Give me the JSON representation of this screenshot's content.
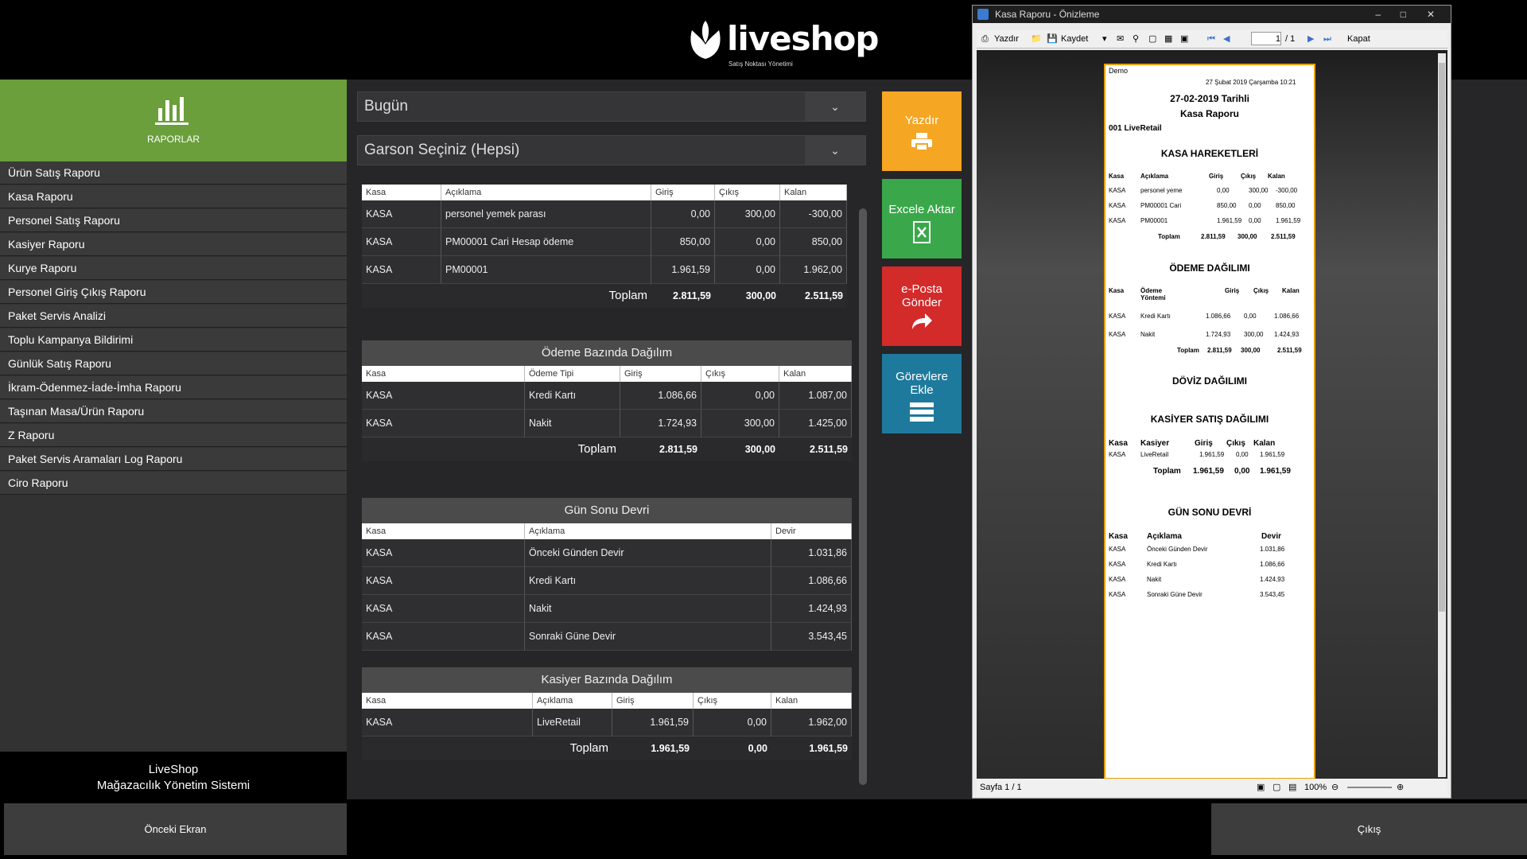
{
  "app": {
    "logo_word": "liveshop",
    "logo_tagline": "Satış Noktası Yönetimi"
  },
  "sidebar": {
    "header_label": "RAPORLAR",
    "items": [
      {
        "label": "Ürün Satış Raporu"
      },
      {
        "label": "Kasa Raporu"
      },
      {
        "label": "Personel Satış Raporu"
      },
      {
        "label": "Kasiyer Raporu"
      },
      {
        "label": "Kurye Raporu"
      },
      {
        "label": "Personel Giriş Çıkış Raporu"
      },
      {
        "label": "Paket Servis Analizi"
      },
      {
        "label": "Toplu Kampanya Bildirimi"
      },
      {
        "label": "Günlük Satış Raporu"
      },
      {
        "label": "İkram-Ödenmez-İade-İmha Raporu"
      },
      {
        "label": "Taşınan Masa/Ürün Raporu"
      },
      {
        "label": "Z Raporu"
      },
      {
        "label": "Paket Servis Aramaları Log Raporu"
      },
      {
        "label": "Ciro Raporu"
      }
    ],
    "brand_line1": "LiveShop",
    "brand_line2": "Mağazacılık Yönetim Sistemi"
  },
  "filters": {
    "date": "Bugün",
    "waiter": "Garson Seçiniz (Hepsi)"
  },
  "kasa_table": {
    "headers": [
      "Kasa",
      "Açıklama",
      "Giriş",
      "Çıkış",
      "Kalan"
    ],
    "rows": [
      [
        "KASA",
        "personel yemek parası",
        "0,00",
        "300,00",
        "-300,00"
      ],
      [
        "KASA",
        "PM00001  Cari Hesap ödeme",
        "850,00",
        "0,00",
        "850,00"
      ],
      [
        "KASA",
        "PM00001",
        "1.961,59",
        "0,00",
        "1.962,00"
      ]
    ],
    "total_label": "Toplam",
    "totals": [
      "2.811,59",
      "300,00",
      "2.511,59"
    ]
  },
  "odeme_table": {
    "title": "Ödeme Bazında Dağılım",
    "headers": [
      "Kasa",
      "Ödeme Tipi",
      "Giriş",
      "Çıkış",
      "Kalan"
    ],
    "rows": [
      [
        "KASA",
        "Kredi Kartı",
        "1.086,66",
        "0,00",
        "1.087,00"
      ],
      [
        "KASA",
        "Nakit",
        "1.724,93",
        "300,00",
        "1.425,00"
      ]
    ],
    "total_label": "Toplam",
    "totals": [
      "2.811,59",
      "300,00",
      "2.511,59"
    ]
  },
  "gunsonu_table": {
    "title": "Gün Sonu Devri",
    "headers": [
      "Kasa",
      "Açıklama",
      "Devir"
    ],
    "rows": [
      [
        "KASA",
        "Önceki Günden Devir",
        "1.031,86"
      ],
      [
        "KASA",
        "Kredi Kartı",
        "1.086,66"
      ],
      [
        "KASA",
        "Nakit",
        "1.424,93"
      ],
      [
        "KASA",
        "Sonraki Güne Devir",
        "3.543,45"
      ]
    ]
  },
  "kasiyer_table": {
    "title": "Kasiyer Bazında Dağılım",
    "headers": [
      "Kasa",
      "Açıklama",
      "Giriş",
      "Çıkış",
      "Kalan"
    ],
    "rows": [
      [
        "KASA",
        "LiveRetail",
        "1.961,59",
        "0,00",
        "1.962,00"
      ]
    ],
    "total_label": "Toplam",
    "totals": [
      "1.961,59",
      "0,00",
      "1.961,59"
    ]
  },
  "actions": {
    "print": "Yazdır",
    "excel": "Excele Aktar",
    "email_l1": "e-Posta",
    "email_l2": "Gönder",
    "task_l1": "Görevlere",
    "task_l2": "Ekle",
    "colors": {
      "print": "#f5a623",
      "excel": "#3aa84a",
      "email": "#d32a2a",
      "task": "#1e7a9c"
    }
  },
  "footer": {
    "back": "Önceki Ekran",
    "exit": "Çıkış"
  },
  "preview": {
    "title": "Kasa Raporu - Önizleme",
    "toolbar": {
      "print": "Yazdır",
      "save": "Kaydet",
      "page_value": "1",
      "page_total": "/ 1",
      "close": "Kapat"
    },
    "status": "Sayfa 1 / 1",
    "zoom": "100%",
    "page": {
      "demo": "Demo",
      "datetime": "27 Şubat 2019 Çarşamba 10:21",
      "date_title": "27-02-2019   Tarihli",
      "report_title": "Kasa Raporu",
      "store": "001 LiveRetail",
      "sec1": "KASA HAREKETLERİ",
      "sec1_headers": [
        "Kasa",
        "Açıklama",
        "Giriş",
        "Çıkış",
        "Kalan"
      ],
      "sec1_rows": [
        [
          "KASA",
          "personel yeme",
          "0,00",
          "300,00",
          "-300,00"
        ],
        [
          "KASA",
          "PM00001 Cari",
          "850,00",
          "0,00",
          "850,00"
        ],
        [
          "KASA",
          "PM00001",
          "1.961,59",
          "0,00",
          "1.961,59"
        ]
      ],
      "sec1_total": [
        "Toplam",
        "2.811,59",
        "300,00",
        "2.511,59"
      ],
      "sec2": "ÖDEME DAĞILIMI",
      "sec2_headers": [
        "Kasa",
        "Ödeme",
        "Yöntemi",
        "Giriş",
        "Çıkış",
        "Kalan"
      ],
      "sec2_rows": [
        [
          "KASA",
          "Kredi Kartı",
          "1.086,66",
          "0,00",
          "1.086,66"
        ],
        [
          "KASA",
          "Nakit",
          "1.724,93",
          "300,00",
          "1.424,93"
        ]
      ],
      "sec2_total": [
        "Toplam",
        "2.811,59",
        "300,00",
        "2.511,59"
      ],
      "sec3": "DÖVİZ DAĞILIMI",
      "sec4": "KASİYER SATIŞ DAĞILIMI",
      "sec4_headers": [
        "Kasa",
        "Kasiyer",
        "Giriş",
        "Çıkış",
        "Kalan"
      ],
      "sec4_rows": [
        [
          "KASA",
          "LiveRetail",
          "1.961,59",
          "0,00",
          "1.961,59"
        ]
      ],
      "sec4_total": [
        "Toplam",
        "1.961,59",
        "0,00",
        "1.961,59"
      ],
      "sec5": "GÜN SONU DEVRİ",
      "sec5_headers": [
        "Kasa",
        "Açıklama",
        "Devir"
      ],
      "sec5_rows": [
        [
          "KASA",
          "Önceki Günden Devir",
          "1.031,86"
        ],
        [
          "KASA",
          "Kredi Kartı",
          "1.086,66"
        ],
        [
          "KASA",
          "Nakit",
          "1.424,93"
        ],
        [
          "KASA",
          "Sonraki Güne Devir",
          "3.543,45"
        ]
      ]
    }
  }
}
